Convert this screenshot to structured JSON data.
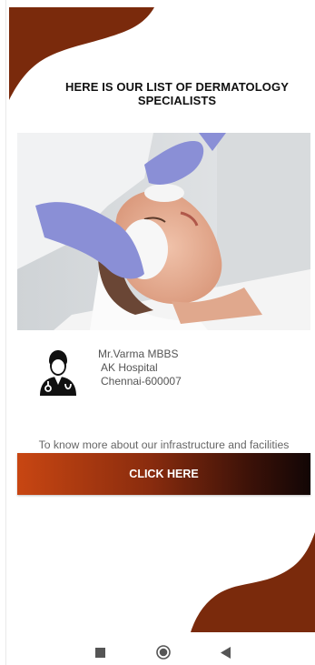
{
  "header": {
    "title_line1": "HERE IS OUR LIST OF DERMATOLOGY",
    "title_line2": "SPECIALISTS"
  },
  "doctor": {
    "name": "Mr.Varma MBBS",
    "hospital": "AK Hospital",
    "address": "Chennai-600007",
    "icon": "doctor-icon"
  },
  "info": {
    "text": "To know more about our infrastructure and facilities"
  },
  "cta": {
    "label": "CLICK HERE"
  },
  "navbar": {
    "icons": [
      "recents-square-icon",
      "home-circle-icon",
      "back-triangle-icon"
    ]
  },
  "colors": {
    "accent": "#7a2a0c",
    "cta_start": "#c84612",
    "cta_end": "#120605"
  }
}
